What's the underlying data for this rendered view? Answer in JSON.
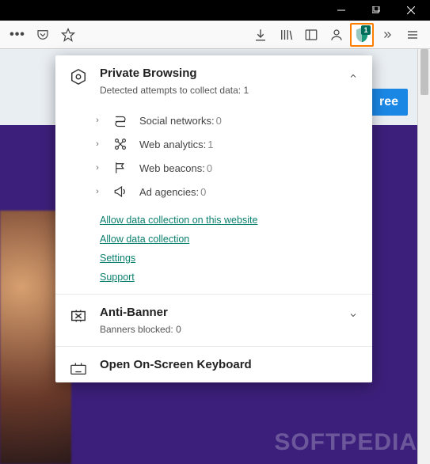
{
  "behind": {
    "partial_button": "ree",
    "watermark": "SOFTPEDIA"
  },
  "extension_badge_count": "1",
  "popup": {
    "private_browsing": {
      "title": "Private Browsing",
      "subtitle_prefix": "Detected attempts to collect data: ",
      "subtitle_count": "1",
      "categories": [
        {
          "label": "Social networks:",
          "count": "0"
        },
        {
          "label": "Web analytics:",
          "count": "1"
        },
        {
          "label": "Web beacons:",
          "count": "0"
        },
        {
          "label": "Ad agencies:",
          "count": "0"
        }
      ],
      "links": {
        "allow_site": "Allow data collection on this website",
        "allow_all": "Allow data collection",
        "settings": "Settings",
        "support": "Support"
      }
    },
    "anti_banner": {
      "title": "Anti-Banner",
      "subtitle_prefix": "Banners blocked: ",
      "subtitle_count": "0"
    },
    "keyboard": {
      "title": "Open On-Screen Keyboard"
    }
  }
}
